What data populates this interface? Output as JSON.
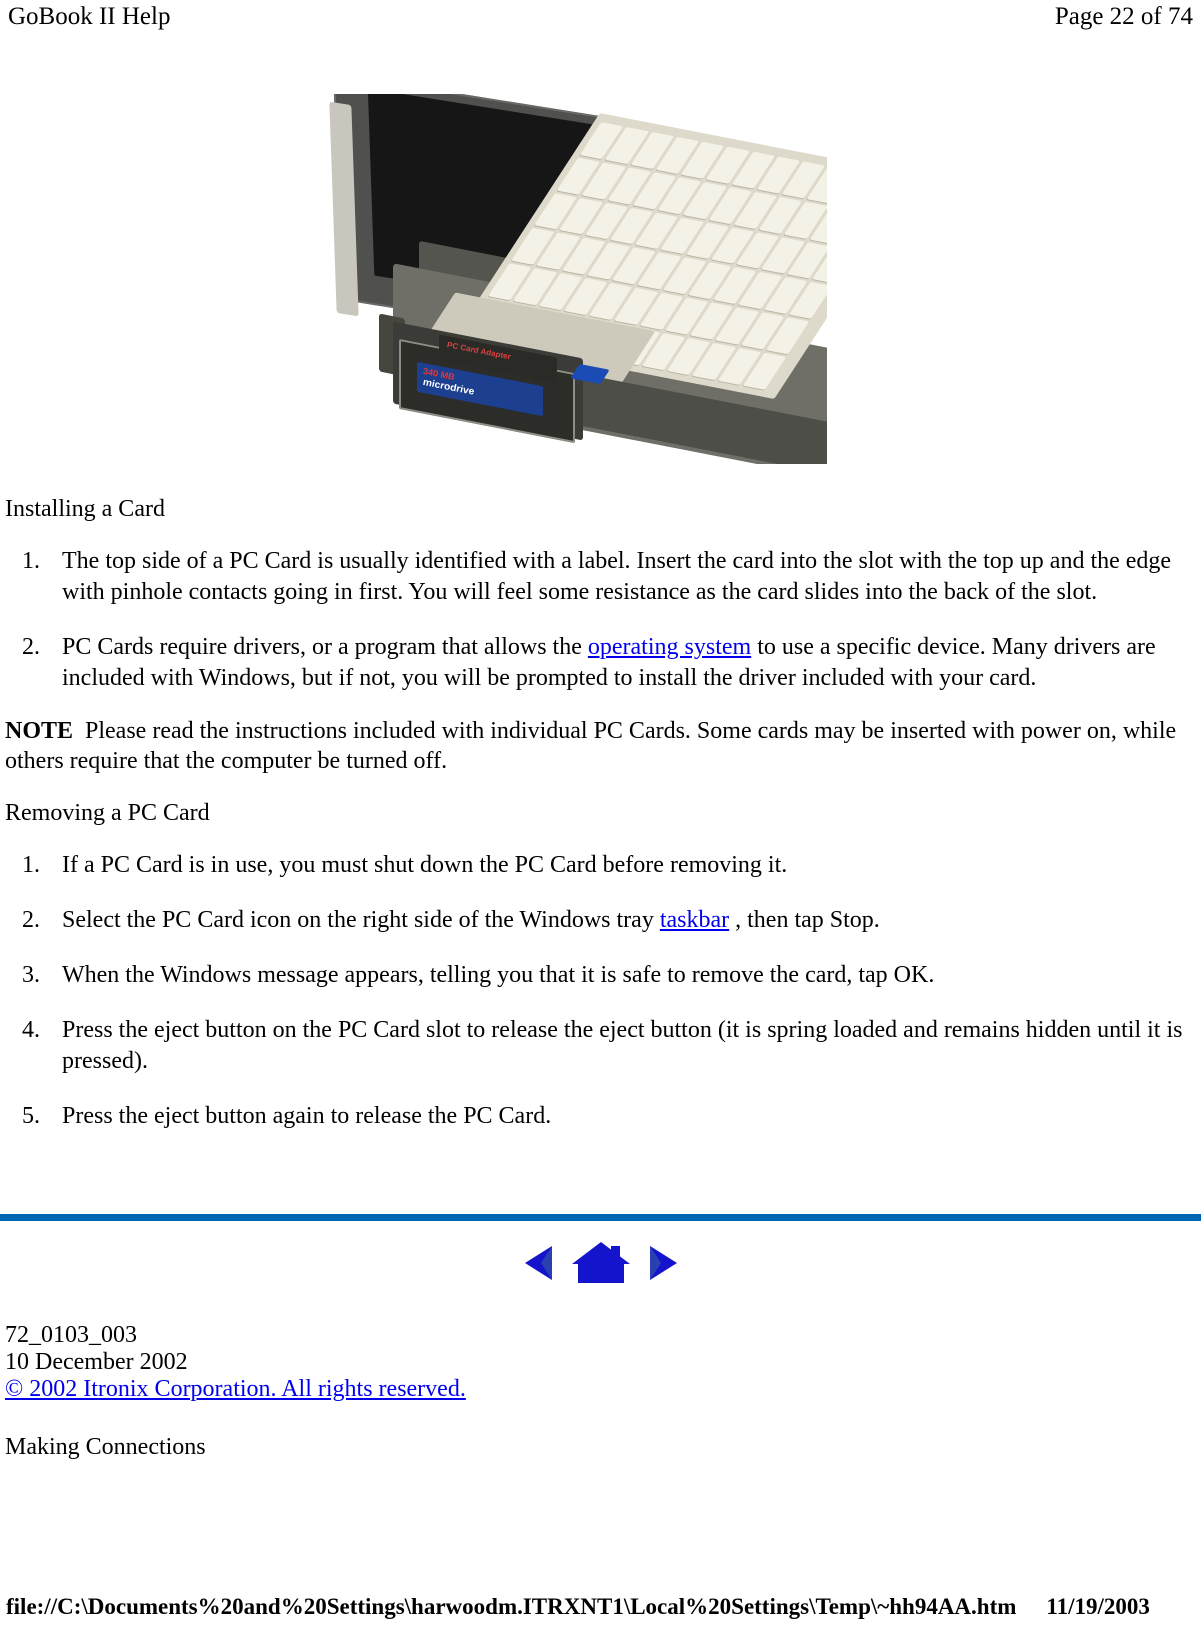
{
  "header": {
    "title": "GoBook II Help",
    "page_indicator": "Page 22 of 74"
  },
  "figure": {
    "alt": "Rugged notebook computer with PC Card slot open and an IBM 340 MB Microdrive card in a PC Card adapter being inserted",
    "card_adapter_label": "PC Card Adapter",
    "card_capacity_label": "340 MB",
    "card_name_label": "microdrive"
  },
  "sections": [
    {
      "heading": "Installing a Card",
      "steps": [
        {
          "number": "1.",
          "parts": [
            {
              "type": "text",
              "value": "The top side of a PC Card is usually identified with a label. Insert the card into the slot with the top up and the edge with pinhole contacts going in first. You will feel some resistance as the card slides into the back of the slot."
            }
          ]
        },
        {
          "number": "2.",
          "parts": [
            {
              "type": "text",
              "value": "PC Cards require drivers, or a program that allows the "
            },
            {
              "type": "link",
              "value": "operating system"
            },
            {
              "type": "text",
              "value": " to use a specific device. Many drivers are included with Windows, but if not, you will be prompted to install the driver included with your card."
            }
          ]
        }
      ]
    }
  ],
  "note": {
    "label": "NOTE",
    "text": "Please read the instructions included with individual PC Cards. Some cards may be inserted with power on, while others require that the computer be turned off."
  },
  "removing_section": {
    "heading": "Removing a PC Card",
    "steps": [
      {
        "number": "1.",
        "parts": [
          {
            "type": "text",
            "value": "If a PC Card is in use, you must shut down the PC Card before removing it."
          }
        ]
      },
      {
        "number": "2.",
        "parts": [
          {
            "type": "text",
            "value": "Select the PC Card icon on the right side of the Windows tray "
          },
          {
            "type": "link",
            "value": "taskbar"
          },
          {
            "type": "text",
            "value": " , then tap Stop."
          }
        ]
      },
      {
        "number": "3.",
        "parts": [
          {
            "type": "text",
            "value": "When the Windows message appears, telling you that it is safe to remove the card, tap OK."
          }
        ]
      },
      {
        "number": "4.",
        "parts": [
          {
            "type": "text",
            "value": "Press the eject button on the PC Card slot to release the eject button (it is spring loaded and remains hidden until it is pressed)."
          }
        ]
      },
      {
        "number": "5.",
        "parts": [
          {
            "type": "text",
            "value": "Press the eject button again to release the PC Card."
          }
        ]
      }
    ]
  },
  "navigation": {
    "back": "back-arrow-icon",
    "home": "home-icon",
    "forward": "forward-arrow-icon"
  },
  "footer": {
    "doc_number": "72_0103_003",
    "doc_date": "10 December 2002",
    "copyright": "© 2002 Itronix Corporation.  All rights reserved.",
    "next_topic": "Making Connections"
  },
  "print_footer": {
    "path": "file://C:\\Documents%20and%20Settings\\harwoodm.ITRXNT1\\Local%20Settings\\Temp\\~hh94AA.htm",
    "date": "11/19/2003"
  },
  "colors": {
    "rule": "#0066b3",
    "link": "#0000ee",
    "nav_icon": "#1414cc"
  }
}
